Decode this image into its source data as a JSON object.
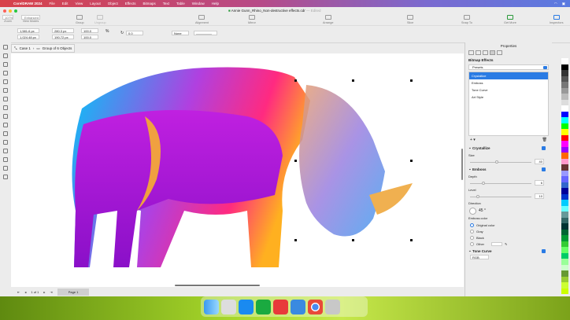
{
  "menubar": {
    "app": "CorelDRAW 2024",
    "items": [
      "File",
      "Edit",
      "View",
      "Layout",
      "Object",
      "Effects",
      "Bitmaps",
      "Text",
      "Table",
      "Window",
      "Help"
    ]
  },
  "window": {
    "title": "Annie Gunn_Rhino_Non-destructive effects.cdr",
    "edited": "— Edited"
  },
  "toolbar": {
    "zoom_value": "107%",
    "zoom": "Zoom",
    "view_mode_value": "Enhanced",
    "view_modes": "View Modes",
    "group": "Group",
    "ungroup": "Ungroup",
    "align": "Alignment",
    "mirror": "Mirror",
    "arrange": "Arrange",
    "slice": "Slice",
    "snap_to": "Snap To",
    "get_more": "Get More",
    "inspectors": "Inspectors"
  },
  "propbar": {
    "x": "1,581.6 px",
    "y": "1,024.48 px",
    "w": "280.3 px",
    "h": "190.72 px",
    "sx": "100.0",
    "sy": "100.0",
    "pct": "%",
    "angle": "0.0",
    "outline": "None"
  },
  "breadcrumb": {
    "layer": "Case 1",
    "group": "Group of 6 Objects"
  },
  "status": {
    "page_count": "1 of 1",
    "page_tab": "Page 1"
  },
  "panel": {
    "title": "Properties",
    "section": "Bitmap Effects",
    "presets": "Presets",
    "effects_list": [
      "Crystallize",
      "Emboss",
      "Tone Curve",
      "Art Style"
    ],
    "crystallize": {
      "title": "Crystallize",
      "size_label": "Size",
      "size": "40",
      "size_pct": 0.42
    },
    "emboss": {
      "title": "Emboss",
      "depth_label": "Depth",
      "depth": "6",
      "depth_pct": 0.2,
      "level_label": "Level",
      "level": "10",
      "level_pct": 0.1,
      "direction_label": "Direction",
      "direction": "45 °",
      "color_label": "Emboss color",
      "options": [
        "Original color",
        "Gray",
        "Black",
        "Other"
      ],
      "selected": "Original color"
    },
    "tone_curve": {
      "title": "Tone Curve",
      "channel": "RGB"
    }
  },
  "palette": [
    "#ffffff",
    "#000000",
    "#333333",
    "#555555",
    "#777777",
    "#999999",
    "#bbbbbb",
    "#dddddd",
    "#ffffff",
    "#0000ff",
    "#00ffff",
    "#00ff00",
    "#ffff00",
    "#ff0000",
    "#ff00ff",
    "#9900ff",
    "#ff6600",
    "#ff99cc",
    "#663333",
    "#9999ff",
    "#6666ff",
    "#3366cc",
    "#000099",
    "#0033cc",
    "#00ccff",
    "#66ffff",
    "#669999",
    "#336666",
    "#003333",
    "#006633",
    "#009933",
    "#33cc33",
    "#66ff66",
    "#00cc66",
    "#99ff99",
    "#ccffcc",
    "#669933",
    "#99cc33",
    "#ccff33",
    "#ccff00"
  ],
  "accent": "#2a7be4"
}
